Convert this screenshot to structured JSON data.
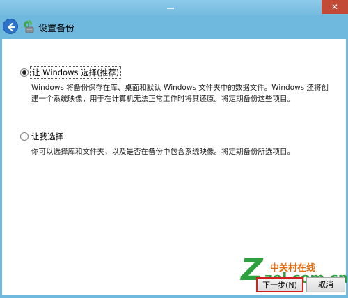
{
  "window": {
    "close_glyph": "✕"
  },
  "nav": {
    "title": "设置备份"
  },
  "options": [
    {
      "label": "让 Windows 选择(推荐)",
      "checked": true,
      "description": "Windows 将备份保存在库、桌面和默认 Windows 文件夹中的数据文件。Windows 还将创建一个系统映像，用于在计算机无法正常工作时将其还原。将定期备份这些项目。"
    },
    {
      "label": "让我选择",
      "checked": false,
      "description": "你可以选择库和文件夹，以及是否在备份中包含系统映像。将定期备份所选项目。"
    }
  ],
  "buttons": {
    "next": "下一步(N)",
    "cancel": "取消"
  },
  "watermark": {
    "logo_letter": "Z",
    "site_name_cn": "中关村在线",
    "site_url": "zol.com.cn"
  }
}
